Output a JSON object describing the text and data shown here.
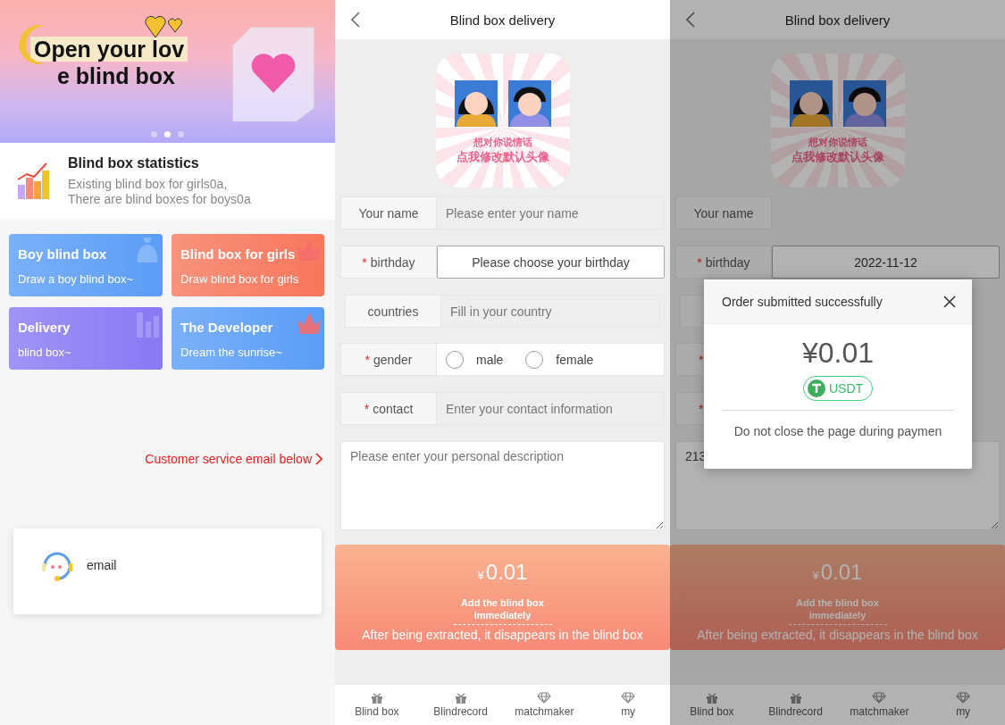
{
  "home": {
    "banner": {
      "lines": [
        "Open your lov",
        "e blind box"
      ],
      "dots": [
        {
          "selected": false
        },
        {
          "selected": true
        },
        {
          "selected": false
        }
      ]
    },
    "stats": {
      "title": "Blind box statistics",
      "lines": [
        "Existing blind box for girls0a,",
        "There are blind boxes for boys0a"
      ]
    },
    "cards": [
      {
        "title": "Boy blind box",
        "subtitle": "Draw a boy blind box~",
        "color": "#5a9df7",
        "kind": "moneybag"
      },
      {
        "title": "Blind box for girls",
        "subtitle": "Draw blind box for girls",
        "color": "#f7775c",
        "kind": "crown"
      },
      {
        "title": "Delivery",
        "subtitle": "blind box~",
        "color": "#8879f4",
        "kind": "chart"
      },
      {
        "title": "The Developer",
        "subtitle": "Dream the sunrise~",
        "color": "#5a9df7",
        "kind": "crown"
      }
    ],
    "service_link": "Customer service email below",
    "contact": {
      "label": "email"
    }
  },
  "delivery": {
    "title": "Blind box delivery",
    "avatar_captions": [
      "想对你说情话",
      "点我修改默认头像"
    ],
    "fields": [
      {
        "kind": "text",
        "label": "Your name",
        "placeholder": "Please enter your name"
      },
      {
        "kind": "picker",
        "label": "birthday",
        "marker": "*",
        "placeholder": "Please choose your birthday"
      },
      {
        "kind": "text",
        "label": "countries",
        "placeholder": "Fill in your country"
      },
      {
        "kind": "radio",
        "label": "gender",
        "marker": "*",
        "options": [
          {
            "label": "male",
            "selected": false
          },
          {
            "label": "female",
            "selected": false
          }
        ]
      },
      {
        "kind": "text",
        "label": "contact",
        "marker": "*",
        "placeholder": "Enter your contact information"
      }
    ],
    "description": {
      "placeholder": "Please enter your personal description"
    },
    "pay": {
      "currency": "¥",
      "amount": "0.01",
      "action": "Add the blind box immediately",
      "note": "After being extracted, it disappears in the blind box"
    },
    "tabbar": [
      {
        "label": "Blind box",
        "kind": "gift"
      },
      {
        "label": "Blindrecord",
        "kind": "gift"
      },
      {
        "label": "matchmaker",
        "kind": "diamond"
      },
      {
        "label": "my",
        "kind": "diamond"
      }
    ]
  },
  "payment": {
    "title": "Blind box delivery",
    "avatar_captions": [
      "想对你说情话",
      "点我修改默认头像"
    ],
    "fields": [
      {
        "kind": "text",
        "label": "Your name"
      },
      {
        "kind": "picker",
        "label": "birthday",
        "marker": "*",
        "value": "2022-11-12"
      },
      {
        "kind": "text"
      },
      {
        "kind": "radio",
        "marker": "*"
      },
      {
        "kind": "text",
        "marker": "*"
      }
    ],
    "description": {
      "value": "213"
    },
    "pay": {
      "currency": "¥",
      "amount": "0.01",
      "action": "Add the blind box immediately",
      "note": "After being extracted, it disappears in the blind box"
    },
    "tabbar": [
      {
        "label": "Blind box",
        "kind": "gift"
      },
      {
        "label": "Blindrecord",
        "kind": "gift"
      },
      {
        "label": "matchmaker",
        "kind": "diamond"
      },
      {
        "label": "my",
        "kind": "diamond"
      }
    ],
    "modal": {
      "title": "Order submitted successfully",
      "price": "¥0.01",
      "method": "USDT",
      "notice": "Do not close the page during paymen"
    }
  }
}
